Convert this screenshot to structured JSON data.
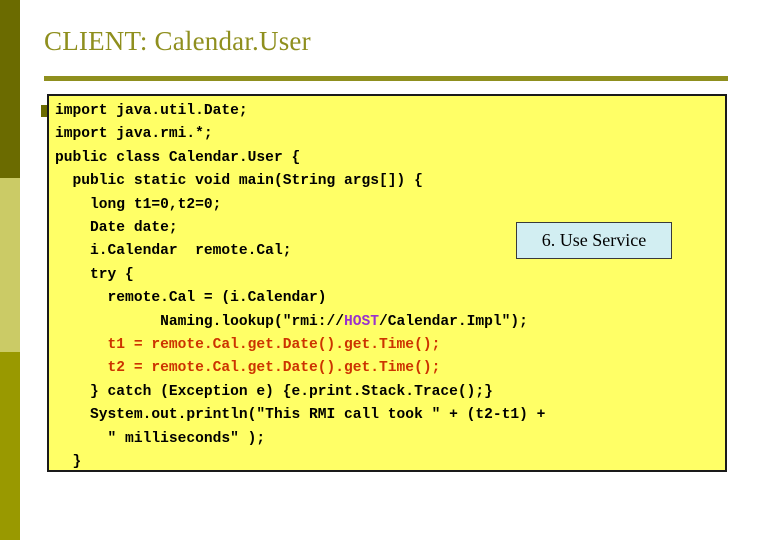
{
  "slide": {
    "title": "CLIENT: Calendar.User",
    "background_color": "#ffffff",
    "accent_color": "#8f8f1e"
  },
  "sidebar": {
    "segments": [
      {
        "name": "band-top",
        "color": "#6b6b00"
      },
      {
        "name": "band-middle",
        "color": "#cbcb66"
      },
      {
        "name": "band-bottom",
        "color": "#999900"
      }
    ]
  },
  "code_block": {
    "background_color": "#ffff66",
    "border_color": "#1a1a1a",
    "language": "java",
    "highlight_colors": {
      "host": "#9933cc",
      "timing": "#cc3300"
    },
    "lines": [
      "import java.util.Date;",
      "import java.rmi.*;",
      "public class Calendar.User {",
      "  public static void main(String args[]) {",
      "    long t1=0,t2=0;",
      "    Date date;",
      "    i.Calendar  remote.Cal;",
      "    try {",
      "      remote.Cal = (i.Calendar)",
      "            Naming.lookup(\"rmi://HOST/Calendar.Impl\");",
      "      t1 = remote.Cal.get.Date().get.Time();",
      "      t2 = remote.Cal.get.Date().get.Time();",
      "    } catch (Exception e) {e.print.Stack.Trace();}",
      "    System.out.println(\"This RMI call took \" + (t2-t1) +",
      "      \" milliseconds\" );",
      "  }",
      "}"
    ]
  },
  "callout": {
    "label": "6. Use Service",
    "background_color": "#d2eef2",
    "border_color": "#3a3a3a",
    "text_color": "#000000"
  }
}
